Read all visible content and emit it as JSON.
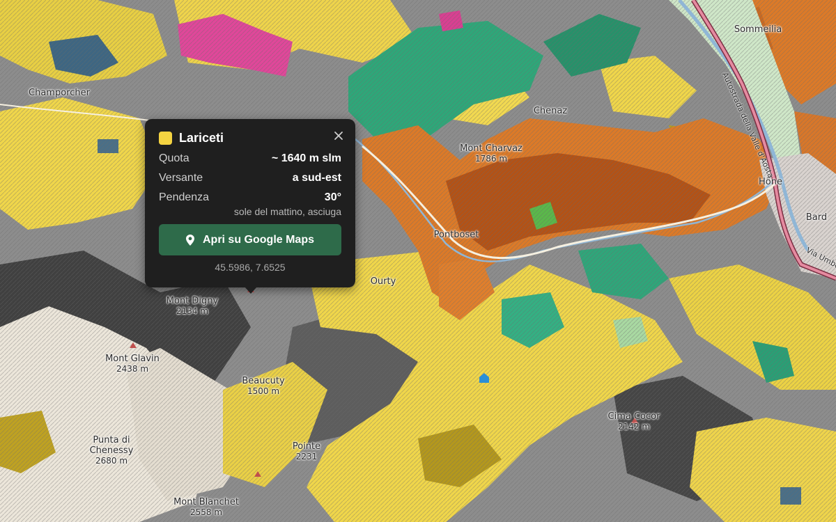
{
  "map": {
    "place_labels": [
      {
        "name": "Champorcher",
        "elev": ""
      },
      {
        "name": "Mont Digny",
        "elev": "2134 m"
      },
      {
        "name": "Mont Glavin",
        "elev": "2438 m"
      },
      {
        "name": "Punta di Chenessy",
        "elev": "2680 m"
      },
      {
        "name": "Mont Blanchet",
        "elev": "2558 m"
      },
      {
        "name": "Pontboset",
        "elev": ""
      },
      {
        "name": "Mont Charvaz",
        "elev": "1786 m"
      },
      {
        "name": "Chenaz",
        "elev": ""
      },
      {
        "name": "Hône",
        "elev": ""
      },
      {
        "name": "Bard",
        "elev": ""
      },
      {
        "name": "Beaucuty",
        "elev": "1500 m"
      },
      {
        "name": "Pointe",
        "elev": "2231"
      },
      {
        "name": "Cima Cocor",
        "elev": "2142 m"
      },
      {
        "name": "Sommeilia",
        "elev": ""
      },
      {
        "name": "Ourty",
        "elev": ""
      }
    ],
    "road_labels": [
      {
        "name": "Autostrada della Valle d'Aosta"
      },
      {
        "name": "Via Umberto"
      }
    ],
    "colors": {
      "larch_yellow": "#f0d64a",
      "beech_orange": "#dc7a28",
      "chestnut_brown": "#b55415",
      "conifer_green": "#2da77a",
      "rock_grey": "#7f7f7f",
      "dark_rock": "#3a3a3a",
      "pasture_light": "#efe9de",
      "heath_magenta": "#e0479a",
      "olive": "#b79a1a"
    }
  },
  "popup": {
    "title": "Lariceti",
    "swatch_color": "#f4d341",
    "close_icon": "close-icon",
    "rows": [
      {
        "key": "Quota",
        "value": "~ 1640 m slm"
      },
      {
        "key": "Versante",
        "value": "a sud-est"
      },
      {
        "key": "Pendenza",
        "value": "30°"
      }
    ],
    "note": "sole del mattino, asciuga",
    "button_label": "Apri su Google Maps",
    "button_icon": "map-pin-icon",
    "coords": "45.5986, 7.6525"
  }
}
